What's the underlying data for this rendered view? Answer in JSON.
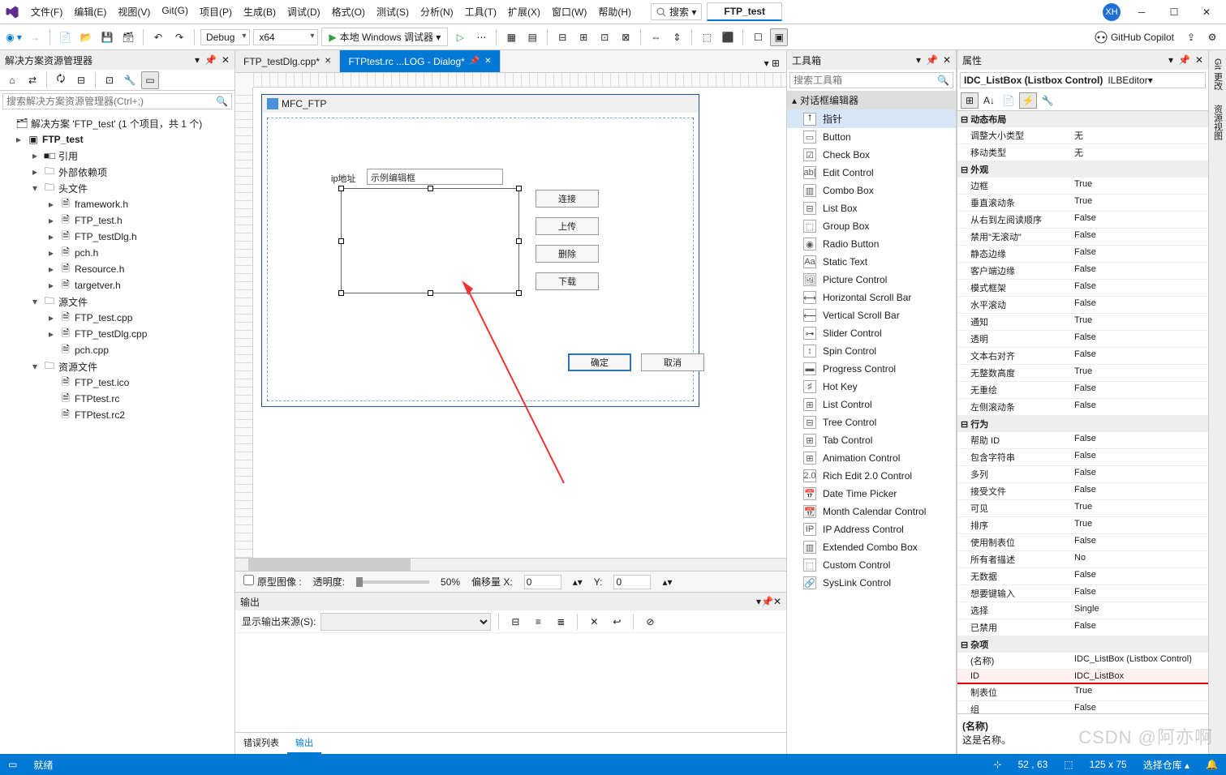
{
  "menu": [
    "文件(F)",
    "编辑(E)",
    "视图(V)",
    "Git(G)",
    "项目(P)",
    "生成(B)",
    "调试(D)",
    "格式(O)",
    "测试(S)",
    "分析(N)",
    "工具(T)",
    "扩展(X)",
    "窗口(W)",
    "帮助(H)"
  ],
  "search_placeholder": "搜索 ▾",
  "project_tab": "FTP_test",
  "user_badge": "XH",
  "toolbar": {
    "config": "Debug",
    "platform": "x64",
    "run": "本地 Windows 调试器 ▾",
    "copilot": "GitHub Copilot"
  },
  "solution": {
    "title": "解决方案资源管理器",
    "search_ph": "搜索解决方案资源管理器(Ctrl+;)",
    "root": "解决方案 'FTP_test' (1 个项目，共 1 个)",
    "proj": "FTP_test",
    "refs": "引用",
    "ext": "外部依赖项",
    "hdr": "头文件",
    "hdr_items": [
      "framework.h",
      "FTP_test.h",
      "FTP_testDlg.h",
      "pch.h",
      "Resource.h",
      "targetver.h"
    ],
    "src": "源文件",
    "src_items": [
      "FTP_test.cpp",
      "FTP_testDlg.cpp",
      "pch.cpp"
    ],
    "res": "资源文件",
    "res_items": [
      "FTP_test.ico",
      "FTPtest.rc",
      "FTPtest.rc2"
    ]
  },
  "tabs": [
    {
      "label": "FTP_testDlg.cpp*",
      "active": false
    },
    {
      "label": "FTPtest.rc ...LOG - Dialog*",
      "active": true
    }
  ],
  "dialog": {
    "title": "MFC_FTP",
    "ip_label": "ip地址",
    "edit_text": "示例编辑框",
    "btns": [
      "连接",
      "上传",
      "删除",
      "下载"
    ],
    "ok": "确定",
    "cancel": "取消"
  },
  "proto": {
    "chk": "原型图像 :",
    "opacity": "透明度:",
    "pct": "50%",
    "offx": "偏移量 X:",
    "offy": "Y:",
    "v0": "0"
  },
  "output": {
    "title": "输出",
    "src_label": "显示输出来源(S):",
    "tabs": [
      "错误列表",
      "输出"
    ]
  },
  "toolbox": {
    "title": "工具箱",
    "search": "搜索工具箱",
    "cat": "对话框编辑器",
    "items": [
      "指针",
      "Button",
      "Check Box",
      "Edit Control",
      "Combo Box",
      "List Box",
      "Group Box",
      "Radio Button",
      "Static Text",
      "Picture Control",
      "Horizontal Scroll Bar",
      "Vertical Scroll Bar",
      "Slider Control",
      "Spin Control",
      "Progress Control",
      "Hot Key",
      "List Control",
      "Tree Control",
      "Tab Control",
      "Animation Control",
      "Rich Edit 2.0 Control",
      "Date Time Picker",
      "Month Calendar Control",
      "IP Address Control",
      "Extended Combo Box",
      "Custom Control",
      "SysLink Control"
    ]
  },
  "props": {
    "title": "属性",
    "obj": "IDC_ListBox (Listbox Control)",
    "editor": "ILBEditor",
    "cats": [
      {
        "name": "动态布局",
        "rows": [
          [
            "调整大小类型",
            "无"
          ],
          [
            "移动类型",
            "无"
          ]
        ]
      },
      {
        "name": "外观",
        "rows": [
          [
            "边框",
            "True"
          ],
          [
            "垂直滚动条",
            "True"
          ],
          [
            "从右到左阅读顺序",
            "False"
          ],
          [
            "禁用\"无滚动\"",
            "False"
          ],
          [
            "静态边缘",
            "False"
          ],
          [
            "客户端边缘",
            "False"
          ],
          [
            "模式框架",
            "False"
          ],
          [
            "水平滚动",
            "False"
          ],
          [
            "通知",
            "True"
          ],
          [
            "透明",
            "False"
          ],
          [
            "文本右对齐",
            "False"
          ],
          [
            "无整数高度",
            "True"
          ],
          [
            "无重绘",
            "False"
          ],
          [
            "左侧滚动条",
            "False"
          ]
        ]
      },
      {
        "name": "行为",
        "rows": [
          [
            "帮助 ID",
            "False"
          ],
          [
            "包含字符串",
            "False"
          ],
          [
            "多列",
            "False"
          ],
          [
            "接受文件",
            "False"
          ],
          [
            "可见",
            "True"
          ],
          [
            "排序",
            "True"
          ],
          [
            "使用制表位",
            "False"
          ],
          [
            "所有者描述",
            "No"
          ],
          [
            "无数据",
            "False"
          ],
          [
            "想要键输入",
            "False"
          ],
          [
            "选择",
            "Single"
          ],
          [
            "已禁用",
            "False"
          ]
        ]
      },
      {
        "name": "杂项",
        "rows": [
          [
            "(名称)",
            "IDC_ListBox (Listbox Control)"
          ],
          [
            "ID",
            "IDC_ListBox"
          ],
          [
            "制表位",
            "True"
          ],
          [
            "组",
            "False"
          ]
        ]
      }
    ],
    "desc_t": "(名称)",
    "desc_b": "这是名称。"
  },
  "side": [
    "Git 更改",
    "资源视图"
  ],
  "status": {
    "ready": "就绪",
    "pos": "52 , 63",
    "size": "125 x 75",
    "repo": "选择仓库 ▴",
    "bell": "🔔"
  },
  "watermark": "CSDN @阿亦啊"
}
